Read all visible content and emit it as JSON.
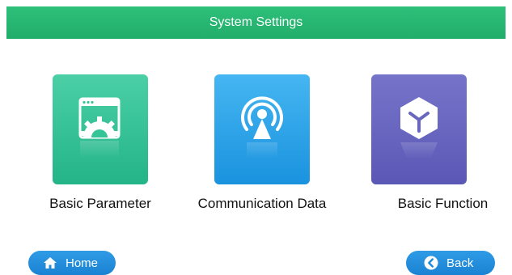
{
  "header": {
    "title": "System Settings",
    "color": "#22b06c"
  },
  "tiles": [
    {
      "label": "Basic Parameter",
      "icon": "settings-window-gear-icon",
      "color": "#35c497"
    },
    {
      "label": "Communication Data",
      "icon": "signal-broadcast-icon",
      "color": "#27a3ea"
    },
    {
      "label": "Basic Function",
      "icon": "y-cube-icon",
      "color": "#6866bf"
    }
  ],
  "footer": {
    "home_label": "Home",
    "back_label": "Back",
    "button_color": "#1f8ad8"
  }
}
